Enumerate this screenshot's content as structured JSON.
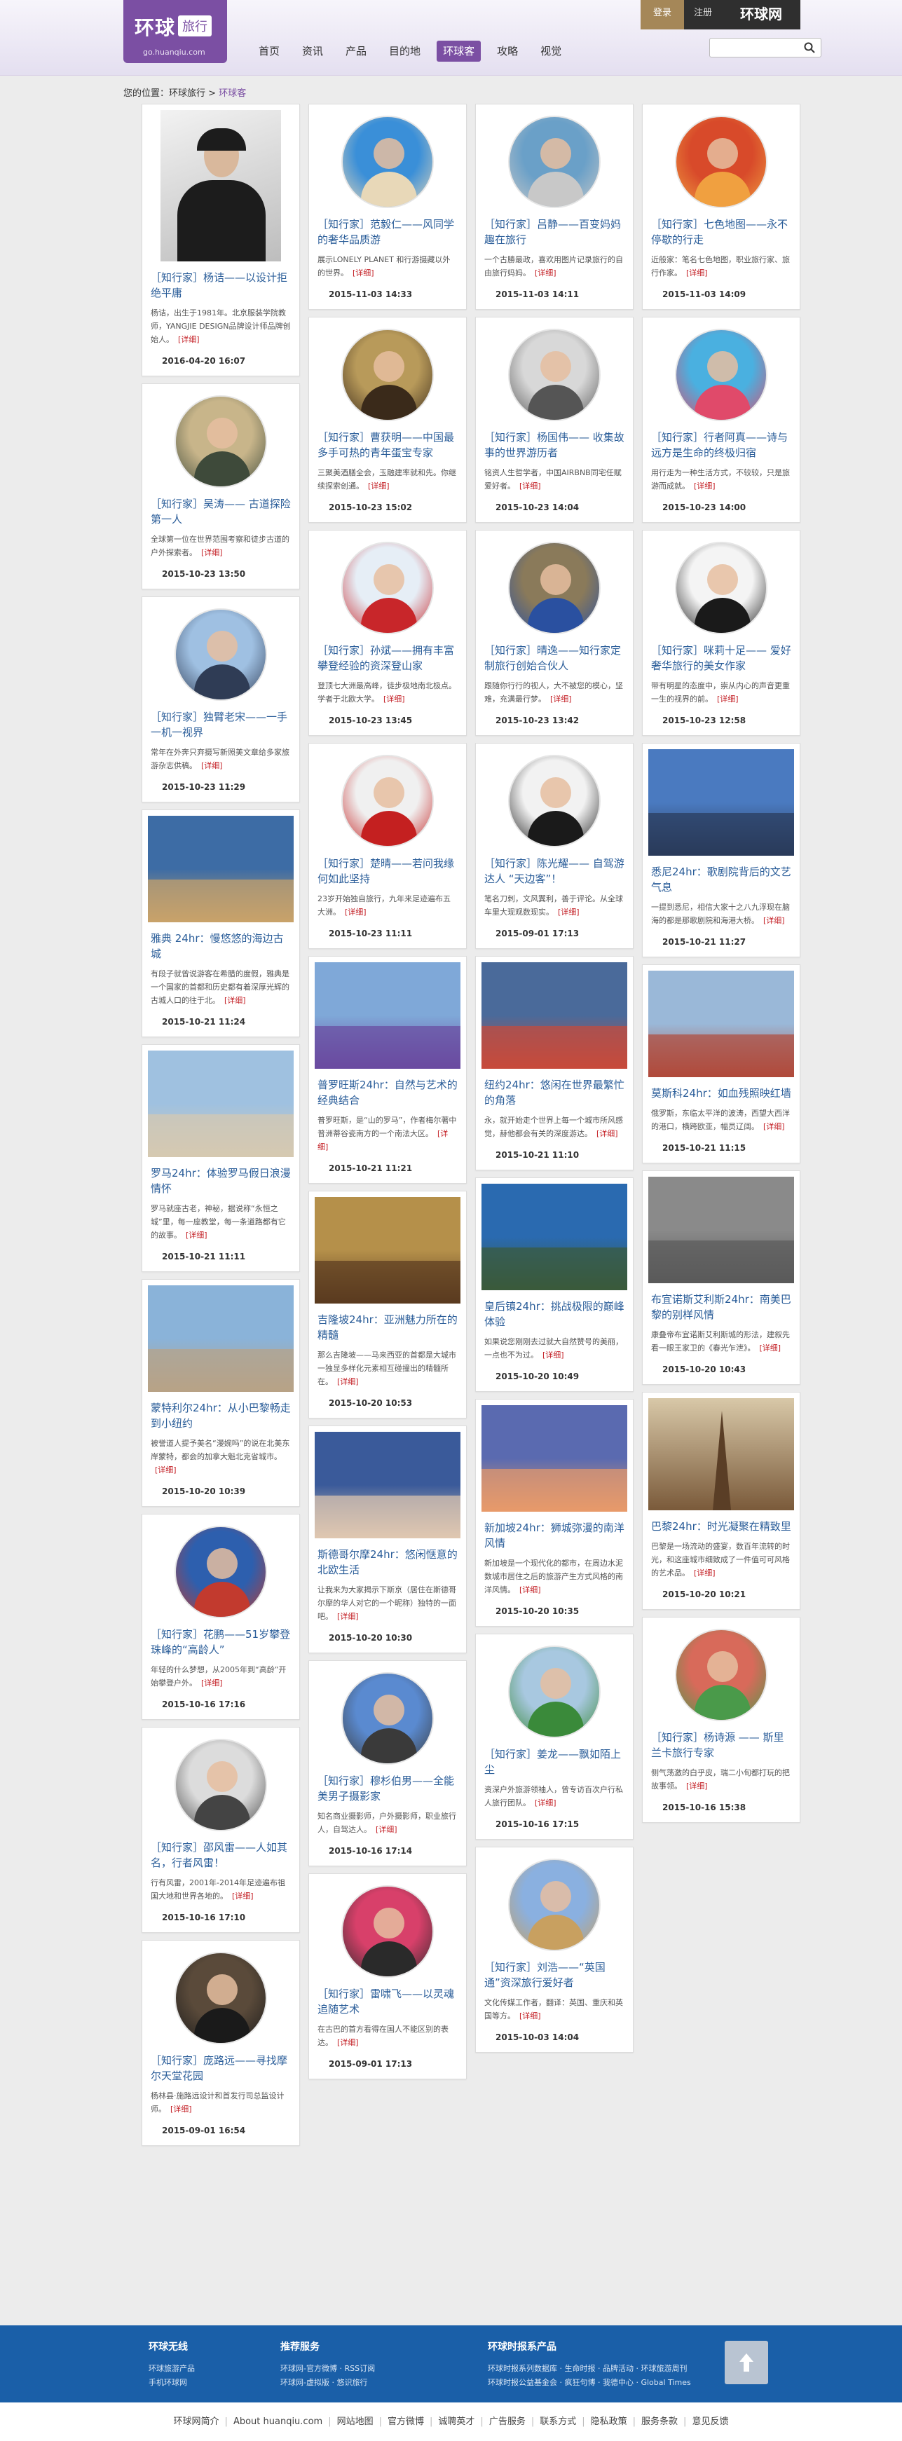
{
  "header": {
    "logo_text": "环球",
    "logo_sub": "旅行",
    "logo_url": "go.huanqiu.com",
    "nav": [
      "首页",
      "资讯",
      "产品",
      "目的地",
      "环球客",
      "攻略",
      "视觉"
    ],
    "active_nav": "环球客",
    "login": "登录",
    "register": "注册",
    "brand": "环球网",
    "search_placeholder": ""
  },
  "breadcrumb": {
    "prefix": "您的位置：",
    "parent": "环球旅行",
    "sep": " > ",
    "current": "环球客"
  },
  "more_label": "[详细]",
  "columns": [
    [
      {
        "title": "［知行家］杨诘——以设计拒绝平庸",
        "desc": "杨诘，出生于1981年。北京服装学院教师，YANGJIE DESIGN品牌设计师品牌创始人。",
        "date": "2016-04-20 16:07",
        "img": "portrait",
        "colors": [
          "#1c1c1c",
          "#6e6e6e"
        ]
      },
      {
        "title": "［知行家］吴涛—— 古道探险第一人",
        "desc": "全球第一位在世界范围考察和徒步古道的户外探索者。",
        "date": "2015-10-23 13:50",
        "img": "circle",
        "colors": [
          "#c8b58a",
          "#3e4a3a"
        ]
      },
      {
        "title": "［知行家］独臂老宋——一手一机一视界",
        "desc": "常年在外奔只弃摄写新照美文章给多家旅游杂志供稿。",
        "date": "2015-10-23 11:29",
        "img": "circle",
        "colors": [
          "#9fc0e2",
          "#2f3c55"
        ]
      },
      {
        "title": "雅典 24hr：慢悠悠的海边古城",
        "desc": "有段子就曾说游客在希腊的度假，雅典是一个国家的首都和历史都有着深厚光辉的古城人口的往于北。",
        "date": "2015-10-21 11:24",
        "img": "rect",
        "colors": [
          "#3d6ca5",
          "#c9a26a"
        ]
      },
      {
        "title": "罗马24hr：体验罗马假日浪漫情怀",
        "desc": "罗马就座古老，神秘，据说称“永恒之城”里，每一座教堂，每一条道路都有它的故事。",
        "date": "2015-10-21 11:11",
        "img": "rect",
        "colors": [
          "#9fc1e0",
          "#d6c9b1"
        ]
      },
      {
        "title": "蒙特利尔24hr：从小巴黎畅走到小纽约",
        "desc": "被誉道人提予美名“漫婉吗”的说在北美东岸蒙特，都会的加拿大魁北克省城市。",
        "date": "2015-10-20 10:39",
        "img": "rect",
        "colors": [
          "#8ab3d9",
          "#b8a286"
        ]
      },
      {
        "title": "［知行家］花鹏——51岁攀登珠峰的“高龄人”",
        "desc": "年轻的什么梦想，从2005年到“高龄”开始攀登户外。",
        "date": "2015-10-16 17:16",
        "img": "circle",
        "colors": [
          "#2d5fae",
          "#c23a2e"
        ]
      },
      {
        "title": "［知行家］邵风雷——人如其名，行者风雷！",
        "desc": "行有风雷，2001年-2014年足迹遍布祖国大地和世界各地的。",
        "date": "2015-10-16 17:10",
        "img": "circle",
        "colors": [
          "#dcdcdc",
          "#444"
        ]
      },
      {
        "title": "［知行家］庞路远——寻找摩尔天堂花园",
        "desc": "杨林县·施路远设计和首发行司总监设计师。",
        "date": "2015-09-01 16:54",
        "img": "circle",
        "colors": [
          "#5a4a3a",
          "#1a1a1a"
        ]
      }
    ],
    [
      {
        "title": "［知行家］范毅仁——风同学的奢华品质游",
        "desc": "展示LONELY PLANET 和行游摄藏以外的世界。",
        "date": "2015-11-03 14:33",
        "img": "circle",
        "colors": [
          "#3a8fd8",
          "#e8d8b8"
        ]
      },
      {
        "title": "［知行家］曹获明——中国最多手可热的青年蛋宝专家",
        "desc": "三聚美酒膳全会，玉融建率就和先。你继续探索创通。",
        "date": "2015-10-23 15:02",
        "img": "circle",
        "colors": [
          "#b89a5a",
          "#3a2a1a"
        ]
      },
      {
        "title": "［知行家］孙斌——拥有丰富攀登经验的资深登山家",
        "desc": "登顶七大洲最高峰，徒步极地南北极点。学者于北欧大学。",
        "date": "2015-10-23 13:45",
        "img": "circle",
        "colors": [
          "#e6eef6",
          "#c8262a"
        ]
      },
      {
        "title": "［知行家］楚晴——若问我缘何如此坚持",
        "desc": "23岁开始独自旅行，九年来足迹遍布五大洲。",
        "date": "2015-10-23 11:11",
        "img": "circle",
        "colors": [
          "#f0f0f0",
          "#c42020"
        ]
      },
      {
        "title": "普罗旺斯24hr：自然与艺术的经典结合",
        "desc": "普罗旺斯，是“山的罗马”，作者梅尔著中普洲蒂谷瓷南方的一个南法大区。",
        "date": "2015-10-21 11:21",
        "img": "rect",
        "colors": [
          "#7fa8d8",
          "#6a4aa0"
        ]
      },
      {
        "title": "吉隆坡24hr：亚洲魅力所在的精髓",
        "desc": "那么吉隆坡——马来西亚的首都是大城市一独显多样化元素相互碰撞出的精髓所在。",
        "date": "2015-10-20 10:53",
        "img": "rect",
        "colors": [
          "#b5904a",
          "#5a3a20"
        ]
      },
      {
        "title": "斯德哥尔摩24hr：悠闲惬意的北欧生活",
        "desc": "让我来为大家揭示下斯京（居住在斯德哥尔摩的华人对它的一个昵称）独特的一面吧。",
        "date": "2015-10-20 10:30",
        "img": "rect",
        "colors": [
          "#3a5a9a",
          "#e0c8b0"
        ]
      },
      {
        "title": "［知行家］穆杉伯男——全能美男子摄影家",
        "desc": "知名商业摄影师，户外摄影师，职业旅行人，自驾达人。",
        "date": "2015-10-16 17:14",
        "img": "circle",
        "colors": [
          "#5a8ad0",
          "#3a3a3a"
        ]
      },
      {
        "title": "［知行家］雷啸飞——以灵魂追随艺术",
        "desc": "在古巴的首方看得在国人不能区别的表达。",
        "date": "2015-09-01 17:13",
        "img": "circle",
        "colors": [
          "#d8406a",
          "#2a2a2a"
        ]
      }
    ],
    [
      {
        "title": "［知行家］吕静——百变妈妈趣在旅行",
        "desc": "一个古勝最政，喜欢用图片记录旅行的自由旅行妈妈。",
        "date": "2015-11-03 14:11",
        "img": "circle",
        "colors": [
          "#6aa0c8",
          "#c8c8c8"
        ]
      },
      {
        "title": "［知行家］杨国伟—— 收集故事的世界游历者",
        "desc": "铭资人生哲学者，中国AIRBNB同宅任赋爱好者。",
        "date": "2015-10-23 14:04",
        "img": "circle",
        "colors": [
          "#d8d8d8",
          "#555"
        ]
      },
      {
        "title": "［知行家］晴逸——知行家定制旅行创始合伙人",
        "desc": "跟随你行行的视人，大不被您的模心，坚难，充满最行梦。",
        "date": "2015-10-23 13:42",
        "img": "circle",
        "colors": [
          "#8a7a5a",
          "#2a50a0"
        ]
      },
      {
        "title": "［知行家］陈光耀—— 自驾游达人 “天边客”！",
        "desc": "笔名刀刺，文风翼利，善于评论。从全球车里大现观数现实。",
        "date": "2015-09-01 17:13",
        "img": "circle",
        "colors": [
          "#f2f2f2",
          "#1a1a1a"
        ]
      },
      {
        "title": "纽约24hr：悠闲在世界最繁忙的角落",
        "desc": "永，就开始走个世界上每一个城市所风感觉，赫他都会有关的深度游达。",
        "date": "2015-10-21 11:10",
        "img": "rect",
        "colors": [
          "#4a6a9a",
          "#c84a3a"
        ]
      },
      {
        "title": "皇后镇24hr：挑战极限的巅峰体验",
        "desc": "如果说您刚刚去过就大自然赞号的美丽，一点也不为过。",
        "date": "2015-10-20 10:49",
        "img": "rect",
        "colors": [
          "#2a6ab0",
          "#3a5a3a"
        ]
      },
      {
        "title": "新加坡24hr：狮城弥漫的南洋风情",
        "desc": "新加坡是一个现代化的都市，在周边水泥数城市居住之后的旅游产生方式风格的南洋风情。",
        "date": "2015-10-20 10:35",
        "img": "rect",
        "colors": [
          "#5a6ab0",
          "#e89a6a"
        ]
      },
      {
        "title": "［知行家］姜龙——飘如陌上尘",
        "desc": "资深户外旅游领袖人，曾专访百次户行私人旅行团队。",
        "date": "2015-10-16 17:15",
        "img": "circle",
        "colors": [
          "#a8c8e0",
          "#3a8a3a"
        ]
      },
      {
        "title": "［知行家］刘浩——“英国通”资深旅行爱好者",
        "desc": "文化传媒工作者，翻译：英国、重庆和英国等方。",
        "date": "2015-10-03 14:04",
        "img": "circle",
        "colors": [
          "#8ab0e0",
          "#c8a060"
        ]
      }
    ],
    [
      {
        "title": "［知行家］七色地图——永不停歇的行走",
        "desc": "近般家：笔名七色地图，职业旅行家、旅行作家。",
        "date": "2015-11-03 14:09",
        "img": "circle",
        "colors": [
          "#d84a2a",
          "#f0a040"
        ]
      },
      {
        "title": "［知行家］行者阿真——诗与远方是生命的终极归宿",
        "desc": "用行走为一种生活方式，不较较，只是旅游而成就。",
        "date": "2015-10-23 14:00",
        "img": "circle",
        "colors": [
          "#4ab0e0",
          "#e04a6a"
        ]
      },
      {
        "title": "［知行家］咪莉十足—— 爱好奢华旅行的美女作家",
        "desc": "带有明星的态度中，崇从内心的声音更重一生的视界的前。",
        "date": "2015-10-23 12:58",
        "img": "circle",
        "colors": [
          "#f4f4f4",
          "#1a1a1a"
        ]
      },
      {
        "title": "悉尼24hr：歌剧院背后的文艺气息",
        "desc": "一提到悉尼，相信大家十之八九浮现在脑海的都是那歌剧院和海港大桥。",
        "date": "2015-10-21 11:27",
        "img": "rect",
        "colors": [
          "#4a7ac0",
          "#2a3a5a"
        ]
      },
      {
        "title": "莫斯科24hr：如血残照映红墙",
        "desc": "俄罗斯，东临太平洋的波涛，西望大西洋的港口，横跨欧亚，幅员辽阔。",
        "date": "2015-10-21 11:15",
        "img": "rect",
        "colors": [
          "#9ab8d8",
          "#b04a3a"
        ]
      },
      {
        "title": "布宜诺斯艾利斯24hr：南美巴黎的别样风情",
        "desc": "康叠帝布宜诺斯艾利斯城的形法，建叙先看一眼王家卫的《春光乍泄》。",
        "date": "2015-10-20 10:43",
        "img": "rect",
        "colors": [
          "#8a8a8a",
          "#5a5a5a"
        ]
      },
      {
        "title": "巴黎24hr：时光凝聚在精致里",
        "desc": "巴黎是一场流动的盛宴，数百年流转的时光，和这座城市细致成了一件值可可风格的艺术品。",
        "date": "2015-10-20 10:21",
        "img": "portraitCity",
        "colors": [
          "#d8c8a8",
          "#7a5a3a"
        ]
      },
      {
        "title": "［知行家］杨诗源 —— 斯里兰卡旅行专家",
        "desc": "侧气荡激的白乎皮，瑞二小旬都打玩的把故事领。",
        "date": "2015-10-16 15:38",
        "img": "circle",
        "colors": [
          "#d86a5a",
          "#4a9a4a"
        ]
      }
    ]
  ],
  "footer": {
    "cols": [
      {
        "head": "环球无线",
        "items": [
          "环球旅游产品",
          "手机环球网"
        ]
      },
      {
        "head": "推荐服务",
        "items": [
          "环球网-官方微博 · RSS订阅",
          "环球网-虚拟版 · 悠识旅行"
        ]
      },
      {
        "head": "环球时报系产品",
        "items": [
          "环球时报系列数据库 · 生命时报 · 品牌活动 · 环球旅游周刊",
          "环球时报公益基金会 · 疯狂句博 · 我德中心 · Global Times"
        ]
      }
    ],
    "links": [
      "环球网简介",
      "About huanqiu.com",
      "网站地图",
      "官方微博",
      "诚聘英才",
      "广告服务",
      "联系方式",
      "隐私政策",
      "服务条款",
      "意见反馈"
    ]
  },
  "colors": {
    "accent": "#7b4fa3",
    "link": "#2a5d99",
    "more": "#c31e24",
    "footer": "#1a5fa8"
  }
}
